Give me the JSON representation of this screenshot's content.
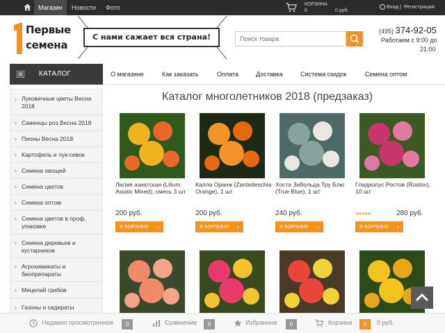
{
  "topbar": {
    "nav": [
      "Магазин",
      "Новости",
      "Фото"
    ],
    "cart_label": "КОРЗИНА",
    "cart_count": "0",
    "cart_sum": "0 руб.",
    "login": "Вход",
    "sep": "|",
    "register": "Регистрация"
  },
  "header": {
    "logo_line1": "Первые",
    "logo_line2": "семена",
    "slogan": "С нами сажает вся страна!",
    "search_placeholder": "Поиск товара",
    "phone_code": "(495)",
    "phone_number": "374-92-05",
    "hours1": "Работаем с 9:00 до",
    "hours2": "21:00"
  },
  "catalog_label": "КАТАЛОГ",
  "mainnav": [
    "О магазине",
    "Как заказать",
    "Оплата",
    "Доставка",
    "Система скидок",
    "Семена оптом"
  ],
  "sidebar": [
    "Луковичные цветы Весна 2018",
    "Саженцы роз Весна 2018",
    "Пионы Весна 2018",
    "Картофель и лук-севок",
    "Семена овощей",
    "Семена цветов",
    "Семена оптом",
    "Семена цветов в проф. упаковке",
    "Семена деревьев и кустарников",
    "Агрохимикаты и биопрепараты",
    "Мицелий грибов",
    "Газоны и сидераты"
  ],
  "page_title": "Каталог многолетников 2018 (предзаказ)",
  "products": [
    {
      "name": "Лилия азиатская (Lilium Asiatic Mixed), смесь 3 шт",
      "price": "200 руб.",
      "button": "В КОРЗИНУ",
      "rating": "",
      "colors": [
        "#2f5a1c",
        "#f0b21e",
        "#e8682a"
      ]
    },
    {
      "name": "Калла Оранж (Zantedeschia Orange), 1 шт",
      "price": "200 руб.",
      "button": "В КОРЗИНУ",
      "rating": "",
      "colors": [
        "#1f2a14",
        "#f2942a",
        "#e36a10"
      ]
    },
    {
      "name": "Хоста Зибольда Тру Блю (True Blue), 1 шт",
      "price": "240 руб.",
      "button": "В КОРЗИНУ",
      "rating": "",
      "colors": [
        "#4d6a66",
        "#86a39c",
        "#e8e8e0"
      ]
    },
    {
      "name": "Гладиолус Ростов (Rostov), 10 шт",
      "price": "280 руб.",
      "button": "В КОРЗИНУ",
      "rating": "★★★★★",
      "colors": [
        "#3d5a25",
        "#c8356a",
        "#e07aa0"
      ]
    },
    {
      "name": "",
      "price": "",
      "button": "",
      "rating": "",
      "colors": [
        "#3b4a2a",
        "#f08a6a",
        "#f4a48a"
      ]
    },
    {
      "name": "",
      "price": "",
      "button": "",
      "rating": "",
      "colors": [
        "#3a4a20",
        "#e83a6a",
        "#f2c230"
      ]
    },
    {
      "name": "",
      "price": "",
      "button": "",
      "rating": "",
      "colors": [
        "#4a3a28",
        "#e8463a",
        "#f2d23a"
      ]
    },
    {
      "name": "",
      "price": "",
      "button": "",
      "rating": "",
      "colors": [
        "#2f4a1a",
        "#f2c21e",
        "#e8a81a"
      ]
    }
  ],
  "footer": {
    "recent": "Недавно просмотренное",
    "recent_count": "0",
    "compare": "Сравнение",
    "compare_count": "0",
    "favorites": "Избранное",
    "favorites_count": "0",
    "cart": "Корзина",
    "cart_count": "0",
    "cart_sum": "0 руб."
  },
  "colors": {
    "accent": "#f29321",
    "dark": "#2b2b2b"
  }
}
